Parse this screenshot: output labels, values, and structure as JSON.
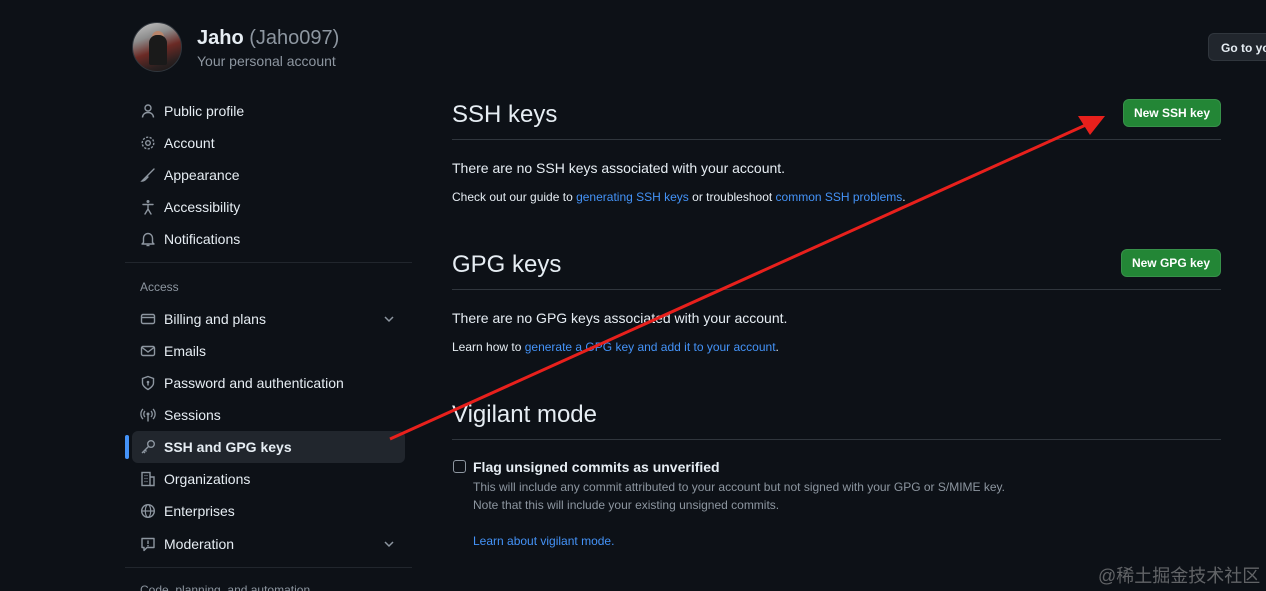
{
  "header": {
    "display_name": "Jaho",
    "handle": "(Jaho097)",
    "subtitle": "Your personal account",
    "goto_button": "Go to yo"
  },
  "sidebar": {
    "items_top": [
      {
        "label": "Public profile",
        "icon": "person-icon"
      },
      {
        "label": "Account",
        "icon": "gear-icon"
      },
      {
        "label": "Appearance",
        "icon": "paintbrush-icon"
      },
      {
        "label": "Accessibility",
        "icon": "accessibility-icon"
      },
      {
        "label": "Notifications",
        "icon": "bell-icon"
      }
    ],
    "access_heading": "Access",
    "items_access": [
      {
        "label": "Billing and plans",
        "icon": "credit-card-icon",
        "expandable": true
      },
      {
        "label": "Emails",
        "icon": "mail-icon"
      },
      {
        "label": "Password and authentication",
        "icon": "shield-lock-icon"
      },
      {
        "label": "Sessions",
        "icon": "broadcast-icon"
      },
      {
        "label": "SSH and GPG keys",
        "icon": "key-icon",
        "active": true
      },
      {
        "label": "Organizations",
        "icon": "organization-icon"
      },
      {
        "label": "Enterprises",
        "icon": "globe-icon"
      },
      {
        "label": "Moderation",
        "icon": "report-icon",
        "expandable": true
      }
    ],
    "next_heading": "Code, planning, and automation"
  },
  "ssh": {
    "title": "SSH keys",
    "button": "New SSH key",
    "empty": "There are no SSH keys associated with your account.",
    "guide_prefix": "Check out our guide to ",
    "guide_link1": "generating SSH keys",
    "guide_mid": " or troubleshoot ",
    "guide_link2": "common SSH problems",
    "guide_suffix": "."
  },
  "gpg": {
    "title": "GPG keys",
    "button": "New GPG key",
    "empty": "There are no GPG keys associated with your account.",
    "learn_prefix": "Learn how to ",
    "learn_link": "generate a GPG key and add it to your account",
    "learn_suffix": "."
  },
  "vigilant": {
    "title": "Vigilant mode",
    "checkbox_label": "Flag unsigned commits as unverified",
    "checked": false,
    "note1": "This will include any commit attributed to your account but not signed with your GPG or S/MIME key.",
    "note2": "Note that this will include your existing unsigned commits.",
    "learn_link": "Learn about vigilant mode."
  },
  "watermark": "@稀土掘金技术社区",
  "colors": {
    "background": "#0d1117",
    "link": "#4493f8",
    "button_green": "#238636",
    "active_indicator": "#4493f8",
    "annotation_arrow": "#e8201c"
  }
}
